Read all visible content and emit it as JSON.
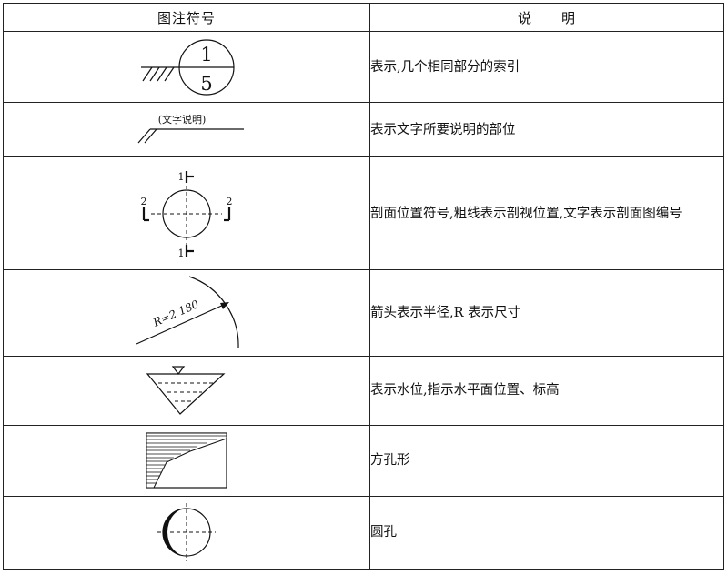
{
  "table": {
    "headers": {
      "symbol": "图注符号",
      "description": "说　　明"
    },
    "rows": [
      {
        "description": "表示,几个相同部分的索引",
        "symbol": {
          "top_number": "1",
          "bottom_number": "5"
        }
      },
      {
        "description": "表示文字所要说明的部位",
        "symbol": {
          "note_label": "(文字说明)"
        }
      },
      {
        "description": "剖面位置符号,粗线表示剖视位置,文字表示剖面图编号",
        "symbol": {
          "label_top": "1",
          "label_bottom": "1",
          "label_left": "2",
          "label_right": "2"
        }
      },
      {
        "description": "箭头表示半径,R 表示尺寸",
        "symbol": {
          "radius_label": "R=2 180"
        }
      },
      {
        "description": "表示水位,指示水平面位置、标高",
        "symbol": {}
      },
      {
        "description": "方孔形",
        "symbol": {}
      },
      {
        "description": "圆孔",
        "symbol": {}
      }
    ]
  }
}
